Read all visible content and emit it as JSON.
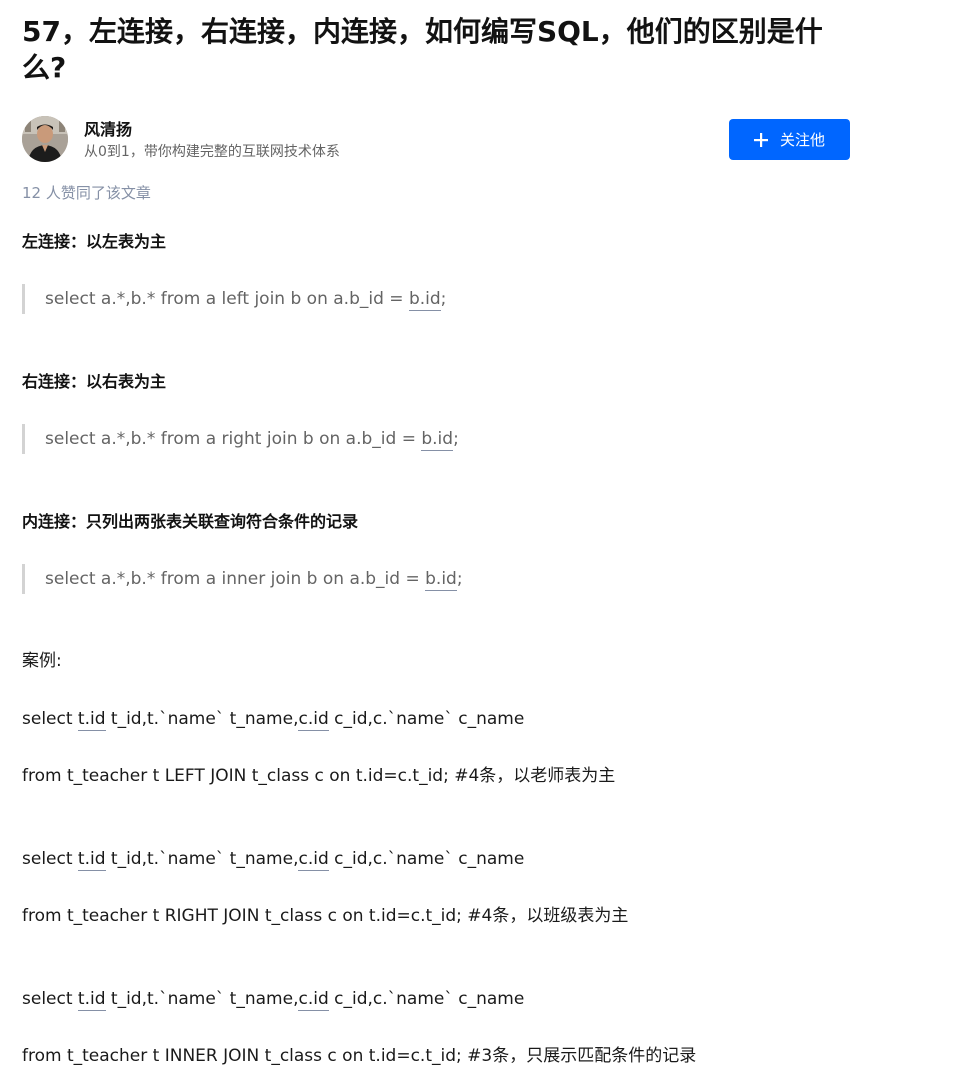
{
  "article": {
    "title": "57，左连接，右连接，内连接，如何编写SQL，他们的区别是什么?",
    "author": {
      "name": "风清扬",
      "description": "从0到1，带你构建完整的互联网技术体系",
      "follow_label": "关注他"
    },
    "likes": "12 人赞同了该文章"
  },
  "sections": [
    {
      "heading": "左连接：以左表为主",
      "code_prefix": "select a.*,b.* from a left join b on a.b_id = ",
      "code_link": "b.id",
      "code_suffix": ";"
    },
    {
      "heading": "右连接：以右表为主",
      "code_prefix": "select a.*,b.* from a right join b on a.b_id = ",
      "code_link": "b.id",
      "code_suffix": ";"
    },
    {
      "heading": "内连接：只列出两张表关联查询符合条件的记录",
      "code_prefix": "select a.*,b.* from a inner join b on a.b_id = ",
      "code_link": "b.id",
      "code_suffix": ";"
    }
  ],
  "example": {
    "label": "案例:",
    "select_parts": {
      "a": "select ",
      "link1": "t.id",
      "b": " t_id,t.`name` t_name,",
      "link2": "c.id",
      "c": " c_id,c.`name` c_name"
    },
    "from_lines": [
      "from t_teacher t LEFT JOIN t_class c on t.id=c.t_id; #4条，以老师表为主",
      "from t_teacher t RIGHT JOIN t_class c on t.id=c.t_id; #4条，以班级表为主",
      "from t_teacher t INNER JOIN t_class c on t.id=c.t_id; #3条，只展示匹配条件的记录"
    ]
  },
  "colors": {
    "primary": "#0066ff",
    "muted": "#8590a6",
    "quote_text": "#646464"
  },
  "icons": {
    "avatar": "author-avatar",
    "follow": "plus-icon"
  }
}
